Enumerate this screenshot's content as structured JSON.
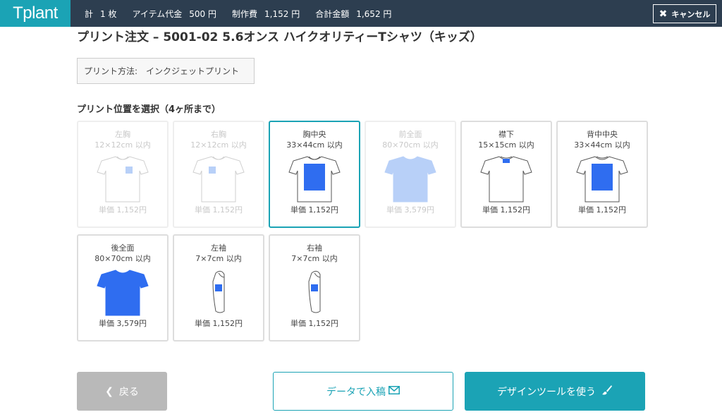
{
  "header": {
    "logo": "Tplant",
    "stats": [
      {
        "label": "計",
        "value": "1 枚"
      },
      {
        "label": "アイテム代金",
        "value": "500 円"
      },
      {
        "label": "制作費",
        "value": "1,152 円"
      },
      {
        "label": "合計金額",
        "value": "1,652 円"
      }
    ],
    "cancel_label": "キャンセル",
    "cancel_icon": "x-icon"
  },
  "page_title": "プリント注文 – 5001-02 5.6オンス ハイクオリティーTシャツ（キッズ）",
  "print_method": {
    "label": "プリント方法:",
    "value": "インクジェットプリント"
  },
  "section_title": "プリント位置を選択（4ヶ所まで）",
  "positions": [
    {
      "name": "左胸",
      "size": "12×12cm 以内",
      "price": "単価 1,152円",
      "state": "disabled",
      "view": "front",
      "print": "chest-small"
    },
    {
      "name": "右胸",
      "size": "12×12cm 以内",
      "price": "単価 1,152円",
      "state": "disabled",
      "view": "front",
      "print": "chest-small-right"
    },
    {
      "name": "胸中央",
      "size": "33×44cm 以内",
      "price": "単価 1,152円",
      "state": "selected",
      "view": "front",
      "print": "chest-large"
    },
    {
      "name": "前全面",
      "size": "80×70cm 以内",
      "price": "単価 3,579円",
      "state": "disabled",
      "view": "front",
      "print": "full"
    },
    {
      "name": "襟下",
      "size": "15×15cm 以内",
      "price": "単価 1,152円",
      "state": "normal",
      "view": "back",
      "print": "collar"
    },
    {
      "name": "背中中央",
      "size": "33×44cm 以内",
      "price": "単価 1,152円",
      "state": "normal",
      "view": "back",
      "print": "back-large"
    },
    {
      "name": "後全面",
      "size": "80×70cm 以内",
      "price": "単価 3,579円",
      "state": "normal",
      "view": "back",
      "print": "full"
    },
    {
      "name": "左袖",
      "size": "7×7cm 以内",
      "price": "単価 1,152円",
      "state": "normal",
      "view": "side",
      "print": "sleeve"
    },
    {
      "name": "右袖",
      "size": "7×7cm 以内",
      "price": "単価 1,152円",
      "state": "normal",
      "view": "side",
      "print": "sleeve"
    }
  ],
  "buttons": {
    "back": "戻る",
    "data_upload": "データで入稿",
    "design_tool": "デザインツールを使う"
  },
  "colors": {
    "accent": "#1ba3b5",
    "header_bg": "#2d3e50",
    "print_blue": "#2f6df0",
    "print_blue_light": "#b8d0f8"
  }
}
